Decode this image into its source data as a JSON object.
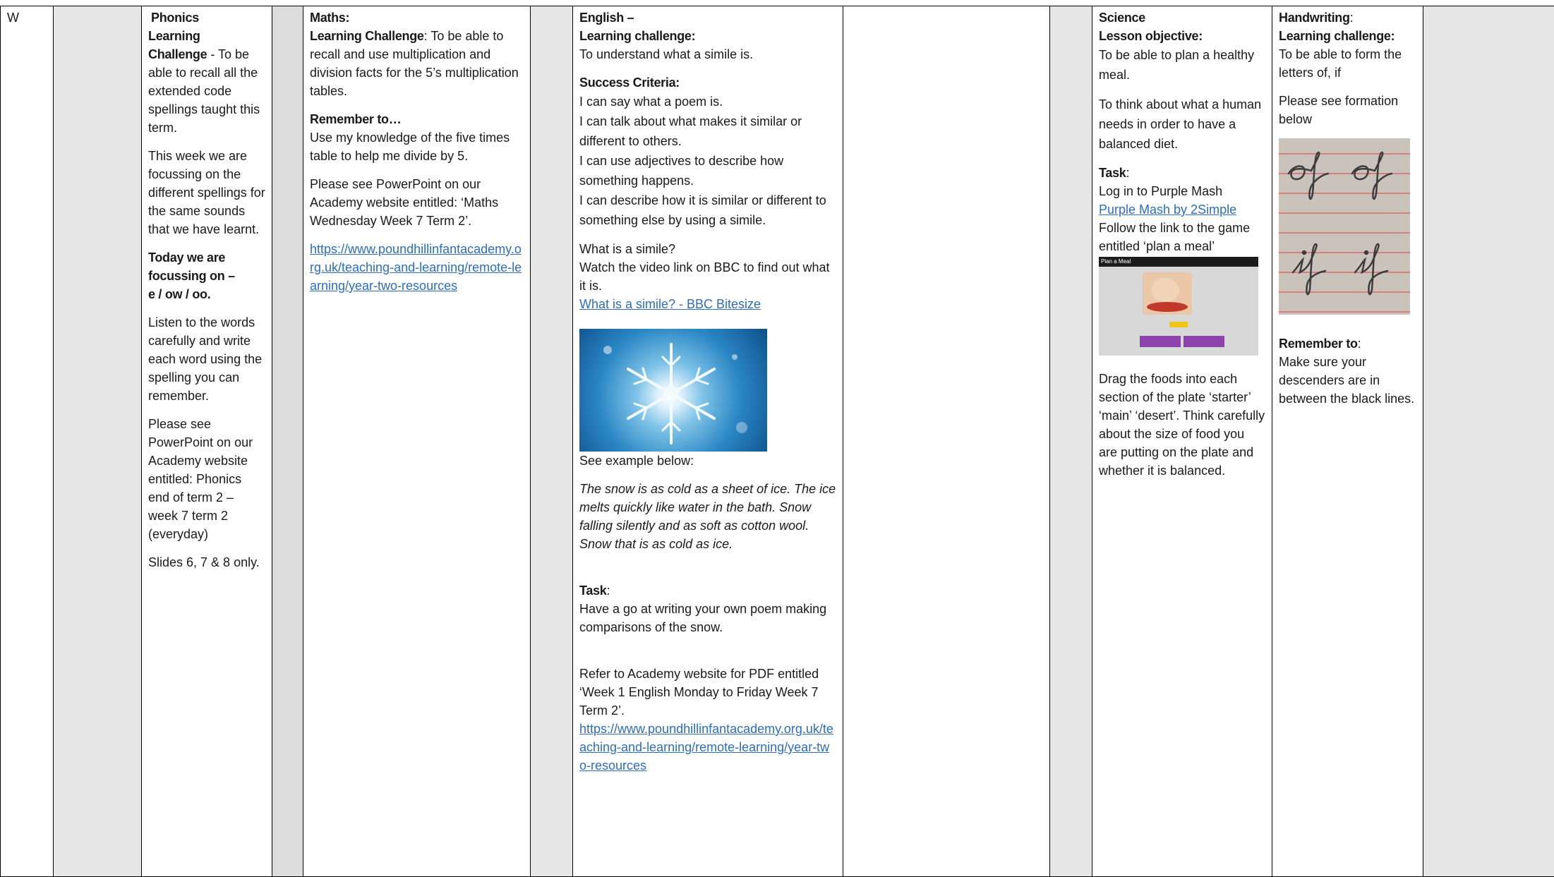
{
  "row_label": "W",
  "phonics": {
    "heading_line1": "Phonics",
    "heading_line2": "Learning",
    "challenge_label": "Challenge",
    "challenge_text": " - To be able to recall all the extended code spellings taught this term.",
    "focus_text": "This week we are focussing on the different spellings for the same sounds that we have learnt.",
    "today_label": "Today we are focussing on –",
    "today_sounds": "e / ow / oo.",
    "instructions": "Listen to the words carefully and write each word using the spelling you can remember.",
    "powerpoint_note": "Please see PowerPoint on our Academy website entitled: Phonics end of term 2 – week 7 term 2 (everyday)",
    "slides_note": "Slides 6, 7 & 8 only."
  },
  "maths": {
    "subject": "Maths:",
    "challenge_label": "Learning Challenge",
    "challenge_text": ": To be able to recall and use multiplication and division facts for the 5’s multiplication tables.",
    "remember_label": "Remember to…",
    "remember_text": "Use my knowledge of the five times table to help me divide by 5.",
    "powerpoint_note": "Please see PowerPoint on our Academy website entitled: ‘Maths Wednesday Week 7 Term 2’.",
    "link_text": "https://www.poundhillinfantacademy.org.uk/teaching-and-learning/remote-learning/year-two-resources"
  },
  "english": {
    "subject": "English –",
    "challenge_label": "Learning challenge:",
    "challenge_text": "To understand what a simile is.",
    "success_label": "Success Criteria:",
    "criteria": [
      " I can say what a poem is.",
      "I can talk about what makes it similar or different to others.",
      "I can use adjectives to describe how something happens.",
      "I can describe how it is similar or different to something else by using a simile."
    ],
    "question": "What is a simile?",
    "video_text": "Watch the video link on BBC to find out what it is.",
    "video_link": " What is a simile? - BBC Bitesize",
    "example_label": "See example below:",
    "example_poem": "The snow is as cold as a sheet of ice. The ice melts quickly like water in the bath. Snow falling silently and as soft as cotton wool. Snow that is as cold as ice.",
    "task_label": "Task",
    "task_colon": ":",
    "task_text": "Have a go at writing your own poem making comparisons of the snow.",
    "refer_text": "Refer to Academy website for PDF entitled ‘Week 1 English Monday to Friday Week 7 Term 2’.",
    "link_text": "https://www.poundhillinfantacademy.org.uk/teaching-and-learning/remote-learning/year-two-resources"
  },
  "science": {
    "subject": "Science",
    "objective_label": "Lesson objective:",
    "objective_text": "To be able to plan a healthy meal.",
    "think_text": "To think about what a human needs in order to have a balanced diet.",
    "task_label": "Task",
    "task_colon": ":",
    "login_text": "Log in to Purple Mash",
    "link_text": " Purple Mash by 2Simple",
    "follow_text": "Follow the link to the game entitled ‘plan a meal’",
    "game_title": "Plan a Meal",
    "drag_text": "Drag the foods into each section of the plate ‘starter’ ‘main’ ‘desert’. Think carefully about the size of food you are putting on the plate and whether it is balanced."
  },
  "handwriting": {
    "subject": "Handwriting",
    "subject_colon": ":",
    "challenge_label": "Learning challenge:",
    "challenge_text": "To be able to form the letters of, if",
    "formation_text": "Please see formation below",
    "remember_label": "Remember to",
    "remember_colon": ":",
    "remember_text": "Make sure your descenders are in between the black lines."
  },
  "colors": {
    "link": "#2e6db8",
    "grey_cell": "#e6e6e6",
    "border": "#000000"
  }
}
